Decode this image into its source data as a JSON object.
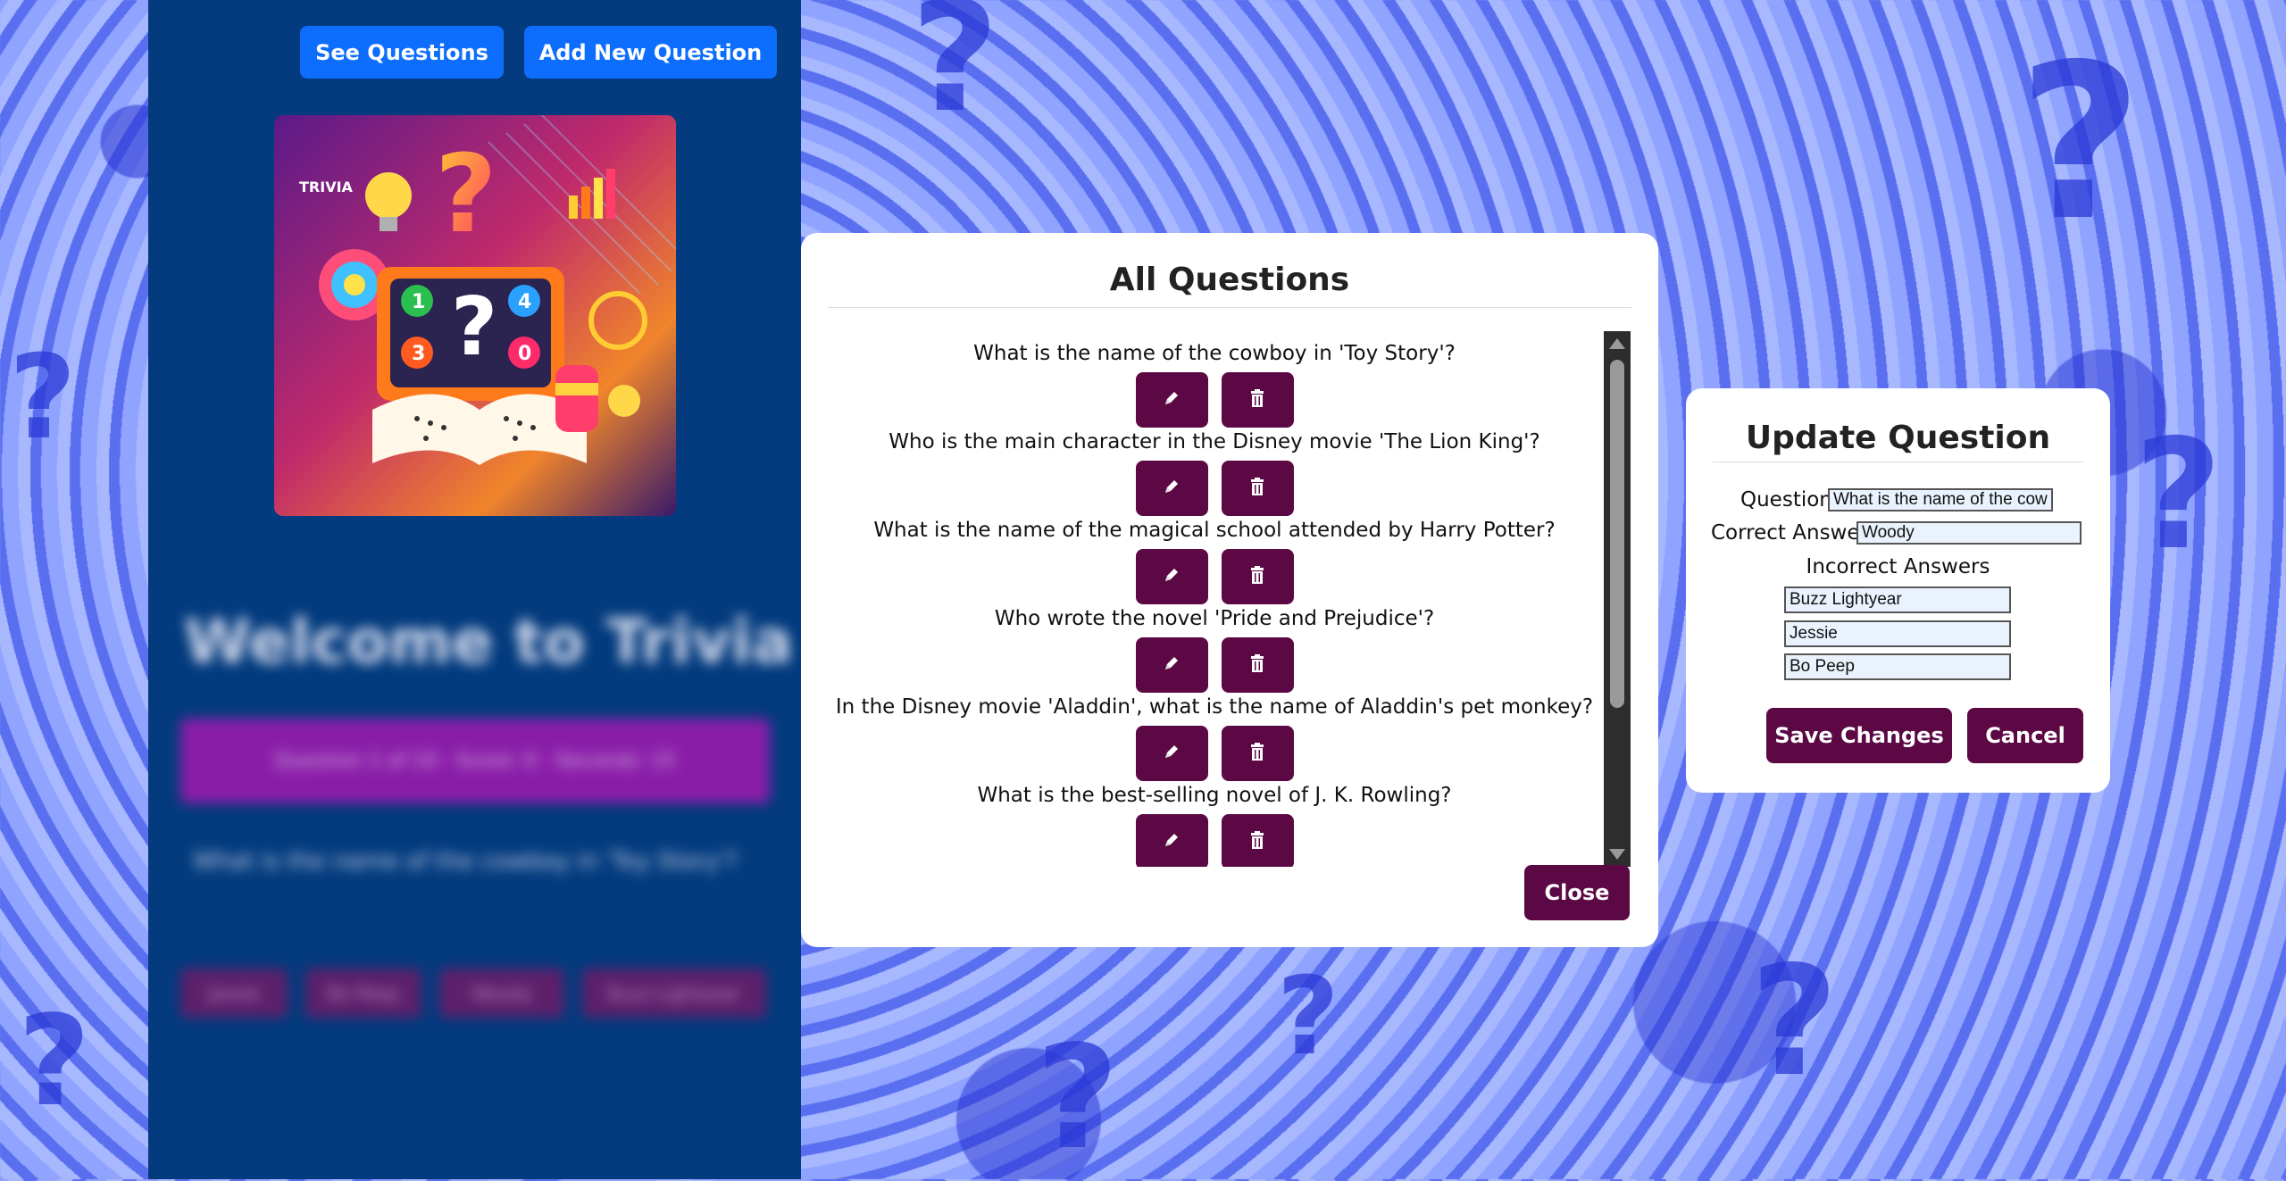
{
  "nav": {
    "see_questions": "See Questions",
    "add_new_question": "Add New Question"
  },
  "image": {
    "text": "TRIVIA",
    "numbers": [
      "1",
      "?",
      "4",
      "3",
      "0"
    ]
  },
  "blurred_home": {
    "title": "Welcome to Trivia",
    "bar_text": "Question 1 of 10 · Score: 0 · Seconds: 15",
    "question": "What is the name of the cowboy in 'Toy Story'?",
    "choices": [
      "Jessie",
      "Bo Peep",
      "Woody",
      "Buzz Lightyear"
    ]
  },
  "modal": {
    "title": "All Questions",
    "close_label": "Close",
    "questions": [
      "What is the name of the cowboy in 'Toy Story'?",
      "Who is the main character in the Disney movie 'The Lion King'?",
      "What is the name of the magical school attended by Harry Potter?",
      "Who wrote the novel 'Pride and Prejudice'?",
      "In the Disney movie 'Aladdin', what is the name of Aladdin's pet monkey?",
      "What is the best-selling novel of J. K. Rowling?"
    ]
  },
  "update": {
    "title": "Update Question",
    "question_label": "Question",
    "question_value": "What is the name of the cowboy in 'Toy Story'?",
    "correct_label": "Correct Answer",
    "correct_value": "Woody",
    "incorrect_label": "Incorrect Answers",
    "incorrect_values": [
      "Buzz Lightyear",
      "Jessie",
      "Bo Peep"
    ],
    "save_label": "Save Changes",
    "cancel_label": "Cancel"
  },
  "colors": {
    "primary_button": "#0d6efd",
    "accent_button": "#5c0845",
    "left_panel": "#033b7e",
    "background": "#6f84f0"
  },
  "icons": {
    "edit": "pencil-icon",
    "delete": "trash-icon"
  }
}
